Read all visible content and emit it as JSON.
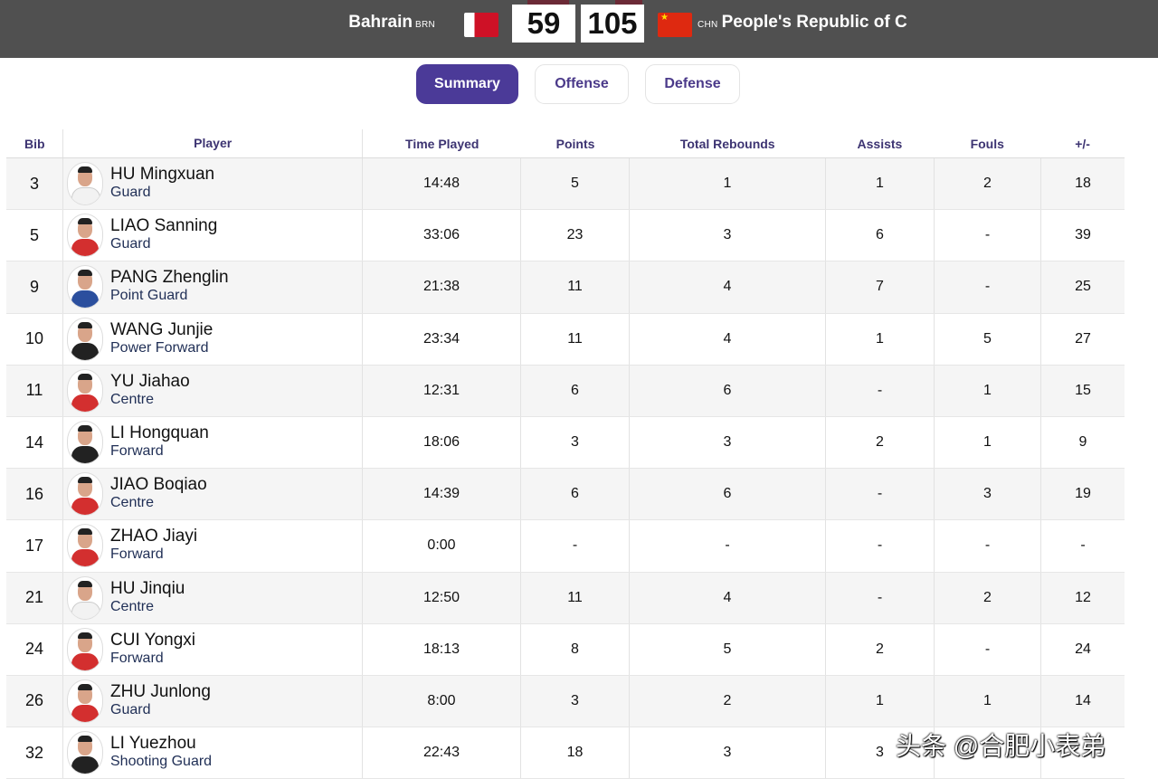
{
  "scoreboard": {
    "left_team": {
      "name": "Bahrain",
      "code": "BRN",
      "score": "59"
    },
    "right_team": {
      "name": "People's Republic of C",
      "code": "CHN",
      "score": "105"
    }
  },
  "tabs": [
    {
      "label": "Summary",
      "active": true
    },
    {
      "label": "Offense",
      "active": false
    },
    {
      "label": "Defense",
      "active": false
    }
  ],
  "columns": [
    "Bib",
    "Player",
    "Time Played",
    "Points",
    "Total Rebounds",
    "Assists",
    "Fouls",
    "+/-"
  ],
  "players": [
    {
      "bib": "3",
      "name": "HU Mingxuan",
      "position": "Guard",
      "time": "14:48",
      "points": "5",
      "rebounds": "1",
      "assists": "1",
      "fouls": "2",
      "plusminus": "18",
      "jersey": "white"
    },
    {
      "bib": "5",
      "name": "LIAO Sanning",
      "position": "Guard",
      "time": "33:06",
      "points": "23",
      "rebounds": "3",
      "assists": "6",
      "fouls": "-",
      "plusminus": "39",
      "jersey": "red"
    },
    {
      "bib": "9",
      "name": "PANG Zhenglin",
      "position": "Point Guard",
      "time": "21:38",
      "points": "11",
      "rebounds": "4",
      "assists": "7",
      "fouls": "-",
      "plusminus": "25",
      "jersey": "blue"
    },
    {
      "bib": "10",
      "name": "WANG Junjie",
      "position": "Power Forward",
      "time": "23:34",
      "points": "11",
      "rebounds": "4",
      "assists": "1",
      "fouls": "5",
      "plusminus": "27",
      "jersey": "black"
    },
    {
      "bib": "11",
      "name": "YU Jiahao",
      "position": "Centre",
      "time": "12:31",
      "points": "6",
      "rebounds": "6",
      "assists": "-",
      "fouls": "1",
      "plusminus": "15",
      "jersey": "red"
    },
    {
      "bib": "14",
      "name": "LI Hongquan",
      "position": "Forward",
      "time": "18:06",
      "points": "3",
      "rebounds": "3",
      "assists": "2",
      "fouls": "1",
      "plusminus": "9",
      "jersey": "black"
    },
    {
      "bib": "16",
      "name": "JIAO Boqiao",
      "position": "Centre",
      "time": "14:39",
      "points": "6",
      "rebounds": "6",
      "assists": "-",
      "fouls": "3",
      "plusminus": "19",
      "jersey": "red"
    },
    {
      "bib": "17",
      "name": "ZHAO Jiayi",
      "position": "Forward",
      "time": "0:00",
      "points": "-",
      "rebounds": "-",
      "assists": "-",
      "fouls": "-",
      "plusminus": "-",
      "jersey": "red"
    },
    {
      "bib": "21",
      "name": "HU Jinqiu",
      "position": "Centre",
      "time": "12:50",
      "points": "11",
      "rebounds": "4",
      "assists": "-",
      "fouls": "2",
      "plusminus": "12",
      "jersey": "white"
    },
    {
      "bib": "24",
      "name": "CUI Yongxi",
      "position": "Forward",
      "time": "18:13",
      "points": "8",
      "rebounds": "5",
      "assists": "2",
      "fouls": "-",
      "plusminus": "24",
      "jersey": "red"
    },
    {
      "bib": "26",
      "name": "ZHU Junlong",
      "position": "Guard",
      "time": "8:00",
      "points": "3",
      "rebounds": "2",
      "assists": "1",
      "fouls": "1",
      "plusminus": "14",
      "jersey": "red"
    },
    {
      "bib": "32",
      "name": "LI Yuezhou",
      "position": "Shooting Guard",
      "time": "22:43",
      "points": "18",
      "rebounds": "3",
      "assists": "3",
      "fouls": "",
      "plusminus": "",
      "jersey": "black"
    }
  ],
  "watermark": "头条 @合肥小表弟",
  "colors": {
    "accent": "#4b3a98",
    "header_bg": "#505050"
  }
}
